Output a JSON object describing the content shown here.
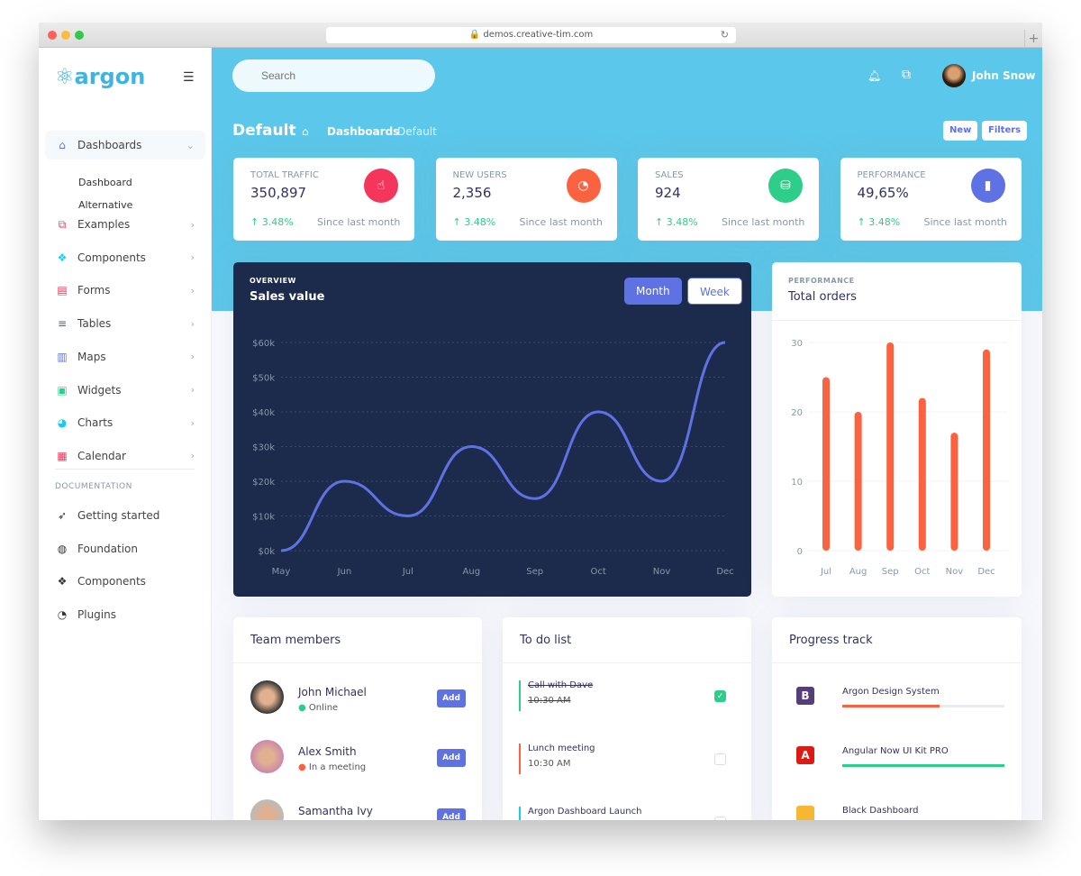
{
  "browser": {
    "url": "demos.creative-tim.com"
  },
  "sidebar": {
    "logo": "argon",
    "items": [
      {
        "label": "Dashboards",
        "icon": "shop-icon",
        "color": "#5e72e4",
        "expanded": true,
        "sub": [
          "Dashboard",
          "Alternative"
        ]
      },
      {
        "label": "Examples",
        "icon": "ungroup-icon",
        "color": "#f5365c"
      },
      {
        "label": "Components",
        "icon": "ui-icon",
        "color": "#11cdef"
      },
      {
        "label": "Forms",
        "icon": "single-copy-icon",
        "color": "#f5365c"
      },
      {
        "label": "Tables",
        "icon": "align-left-icon",
        "color": "#525f7f"
      },
      {
        "label": "Maps",
        "icon": "map-icon",
        "color": "#5e72e4"
      },
      {
        "label": "Widgets",
        "icon": "archive-icon",
        "color": "#2dce89"
      },
      {
        "label": "Charts",
        "icon": "pie-chart-icon",
        "color": "#11cdef"
      },
      {
        "label": "Calendar",
        "icon": "calendar-icon",
        "color": "#f5365c"
      }
    ],
    "doc_heading": "DOCUMENTATION",
    "docs": [
      {
        "label": "Getting started",
        "icon": "spaceship-icon"
      },
      {
        "label": "Foundation",
        "icon": "palette-icon"
      },
      {
        "label": "Components",
        "icon": "ui-icon"
      },
      {
        "label": "Plugins",
        "icon": "chart-pie-icon"
      }
    ]
  },
  "header": {
    "search_placeholder": "Search",
    "user": "John Snow"
  },
  "page": {
    "title": "Default",
    "breadcrumb": [
      "Dashboards",
      "Default"
    ],
    "new_label": "New",
    "filters_label": "Filters"
  },
  "stats": [
    {
      "label": "TOTAL TRAFFIC",
      "value": "350,897",
      "change": "3.48%",
      "since": "Since last month",
      "color": "#f5365c"
    },
    {
      "label": "NEW USERS",
      "value": "2,356",
      "change": "3.48%",
      "since": "Since last month",
      "color": "#fb6340"
    },
    {
      "label": "SALES",
      "value": "924",
      "change": "3.48%",
      "since": "Since last month",
      "color": "#2dce89"
    },
    {
      "label": "PERFORMANCE",
      "value": "49,65%",
      "change": "3.48%",
      "since": "Since last month",
      "color": "#5e72e4"
    }
  ],
  "chart_data": [
    {
      "type": "line",
      "overline": "OVERVIEW",
      "title": "Sales value",
      "toggles": [
        "Month",
        "Week"
      ],
      "active_toggle": "Month",
      "categories": [
        "May",
        "Jun",
        "Jul",
        "Aug",
        "Sep",
        "Oct",
        "Nov",
        "Dec"
      ],
      "values": [
        0,
        20,
        10,
        30,
        15,
        40,
        20,
        60
      ],
      "yticks": [
        "$0k",
        "$10k",
        "$20k",
        "$30k",
        "$40k",
        "$50k",
        "$60k"
      ],
      "ylim": [
        0,
        60
      ],
      "grid": true,
      "color": "#5e72e4"
    },
    {
      "type": "bar",
      "overline": "PERFORMANCE",
      "title": "Total orders",
      "categories": [
        "Jul",
        "Aug",
        "Sep",
        "Oct",
        "Nov",
        "Dec"
      ],
      "values": [
        25,
        20,
        30,
        22,
        17,
        29
      ],
      "yticks": [
        "0",
        "10",
        "20",
        "30"
      ],
      "ylim": [
        0,
        30
      ],
      "grid": true,
      "color": "#fb6340"
    }
  ],
  "team": {
    "title": "Team members",
    "add_label": "Add",
    "members": [
      {
        "name": "John Michael",
        "status": "Online",
        "status_color": "#2dce89"
      },
      {
        "name": "Alex Smith",
        "status": "In a meeting",
        "status_color": "#fb6340"
      },
      {
        "name": "Samantha Ivy",
        "status": "",
        "status_color": "#f5365c"
      }
    ]
  },
  "todo": {
    "title": "To do list",
    "items": [
      {
        "title": "Call with Dave",
        "time": "10:30 AM",
        "done": true,
        "color": "#2dce89"
      },
      {
        "title": "Lunch meeting",
        "time": "10:30 AM",
        "done": false,
        "color": "#fb6340"
      },
      {
        "title": "Argon Dashboard Launch",
        "time": "",
        "done": false,
        "color": "#11cdef"
      }
    ]
  },
  "progress": {
    "title": "Progress track",
    "items": [
      {
        "name": "Argon Design System",
        "percent": 60,
        "color": "#fb6340",
        "logo": "B"
      },
      {
        "name": "Angular Now UI Kit PRO",
        "percent": 100,
        "color": "#2dce89",
        "logo": "A"
      },
      {
        "name": "Black Dashboard",
        "percent": 0,
        "color": "#f5365c",
        "logo": ""
      }
    ]
  }
}
